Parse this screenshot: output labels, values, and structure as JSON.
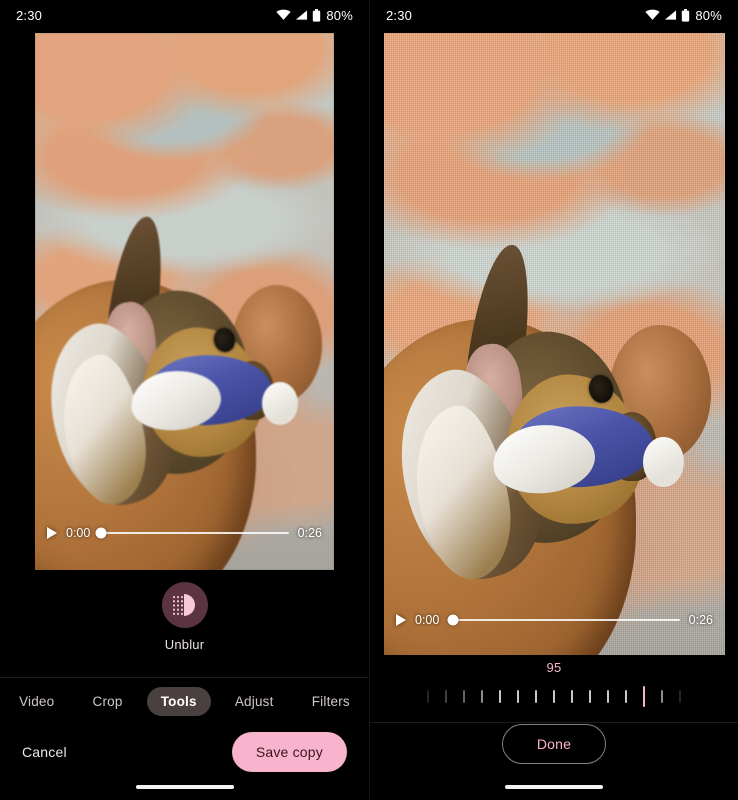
{
  "status_bar": {
    "time": "2:30",
    "wifi_icon": "wifi-icon",
    "signal_icon": "cell-signal-icon",
    "battery_icon": "battery-icon",
    "battery_text": "80%"
  },
  "left_panel": {
    "video": {
      "play_icon": "play-icon",
      "current_time": "0:00",
      "total_time": "0:26",
      "progress_percent": 1,
      "subject": "dog chewing a blue and white plush toy on a patterned carpet"
    },
    "tool": {
      "icon": "unblur-icon",
      "label": "Unblur"
    },
    "tabs": [
      {
        "label": "Video",
        "active": false
      },
      {
        "label": "Crop",
        "active": false
      },
      {
        "label": "Tools",
        "active": true
      },
      {
        "label": "Adjust",
        "active": false
      },
      {
        "label": "Filters",
        "active": false
      }
    ],
    "actions": {
      "cancel_label": "Cancel",
      "save_label": "Save copy"
    }
  },
  "right_panel": {
    "video": {
      "play_icon": "play-icon",
      "current_time": "0:00",
      "total_time": "0:26",
      "progress_percent": 2
    },
    "slider": {
      "value": "95",
      "tick_count": 15,
      "current_tick_index": 12
    },
    "actions": {
      "done_label": "Done"
    }
  },
  "colors": {
    "accent_pink": "#f8b4cd",
    "background": "#000000",
    "tab_active_bg": "#4a403f",
    "tool_circle_bg": "#5c3340"
  }
}
